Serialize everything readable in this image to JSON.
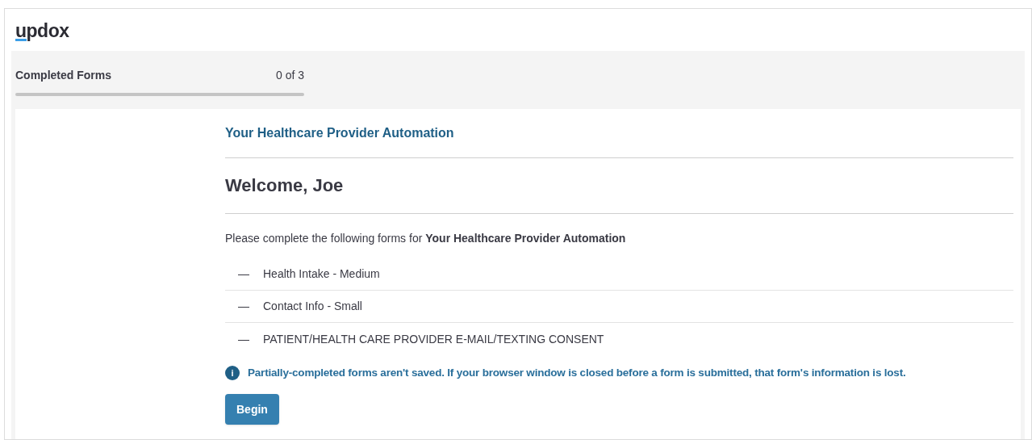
{
  "logo": {
    "text": "updox"
  },
  "progress": {
    "label": "Completed Forms",
    "count": "0 of 3",
    "level": 0
  },
  "provider": "Your Healthcare Provider Automation",
  "heading": "Welcome, Joe",
  "intro": "Please complete the following forms for **Your Healthcare Provider Automation**",
  "forms": [
    {
      "marker": "—",
      "name": "Health Intake - Medium"
    },
    {
      "marker": "—",
      "name": "Contact Info - Small"
    },
    {
      "marker": "—",
      "name": "PATIENT/HEALTH CARE PROVIDER E-MAIL/TEXTING CONSENT"
    }
  ],
  "notice": {
    "icon": "i",
    "text": "Partially-completed forms aren't saved. If your browser window is closed before a form is submitted, that form's information is lost."
  },
  "buttons": [
    "Begin"
  ]
}
